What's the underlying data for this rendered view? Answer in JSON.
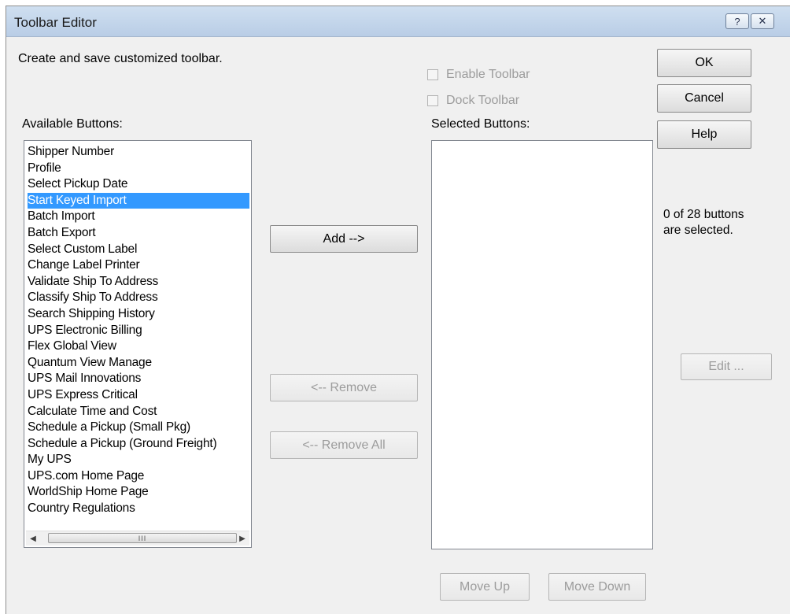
{
  "window": {
    "title": "Toolbar Editor",
    "help_glyph": "?",
    "close_glyph": "✕"
  },
  "intro_text": "Create and save customized toolbar.",
  "options": {
    "enable_toolbar": "Enable Toolbar",
    "dock_toolbar": "Dock Toolbar"
  },
  "available": {
    "label": "Available Buttons:",
    "selected_index": 3,
    "items": [
      "Shipper Number",
      "Profile",
      "Select Pickup Date",
      "Start Keyed Import",
      "Batch Import",
      "Batch Export",
      "Select Custom Label",
      "Change Label Printer",
      "Validate Ship To Address",
      "Classify Ship To Address",
      "Search Shipping History",
      "UPS Electronic Billing",
      "Flex Global View",
      "Quantum View Manage",
      "UPS Mail Innovations",
      "UPS Express Critical",
      "Calculate Time and Cost",
      "Schedule a Pickup (Small Pkg)",
      "Schedule a Pickup (Ground Freight)",
      "My UPS",
      "UPS.com Home Page",
      "WorldShip Home Page",
      "Country Regulations"
    ],
    "scroll_thumb_glyph": "III"
  },
  "selected": {
    "label": "Selected Buttons:",
    "items": []
  },
  "buttons": {
    "add": "Add -->",
    "remove": "<-- Remove",
    "remove_all": "<-- Remove All",
    "ok": "OK",
    "cancel": "Cancel",
    "help": "Help",
    "edit": "Edit ...",
    "move_up": "Move Up",
    "move_down": "Move Down"
  },
  "status": {
    "line1": "0 of 28 buttons",
    "line2": "are selected."
  }
}
